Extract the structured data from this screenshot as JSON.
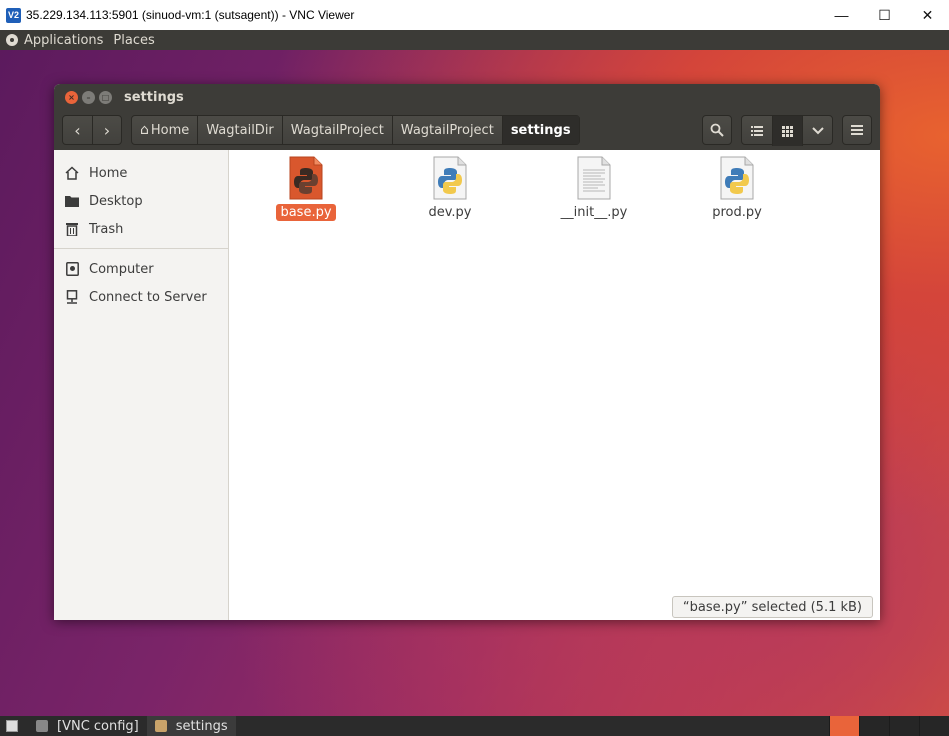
{
  "vnc": {
    "logo": "V2",
    "title": "35.229.134.113:5901 (sinuod-vm:1 (sutsagent)) - VNC Viewer",
    "minimize": "—",
    "maximize": "☐",
    "close": "✕"
  },
  "top_panel": {
    "applications": "Applications",
    "places": "Places"
  },
  "window": {
    "title": "settings",
    "nav": {
      "back": "‹",
      "forward": "›"
    },
    "breadcrumbs": [
      "Home",
      "WagtailDir",
      "WagtailProject",
      "WagtailProject",
      "settings"
    ],
    "tools": {
      "search": "🔍",
      "list_view": "☰",
      "grid_view": "⋮⋮",
      "view_options": "⌄",
      "menu": "≡"
    }
  },
  "sidebar": {
    "items": [
      {
        "label": "Home",
        "icon": "home-icon"
      },
      {
        "label": "Desktop",
        "icon": "folder-icon"
      },
      {
        "label": "Trash",
        "icon": "trash-icon"
      },
      {
        "label": "Computer",
        "icon": "computer-icon"
      },
      {
        "label": "Connect to Server",
        "icon": "server-icon"
      }
    ]
  },
  "files": [
    {
      "name": "base.py",
      "type": "python",
      "selected": true
    },
    {
      "name": "dev.py",
      "type": "python",
      "selected": false
    },
    {
      "name": "__init__.py",
      "type": "text",
      "selected": false
    },
    {
      "name": "prod.py",
      "type": "python",
      "selected": false
    }
  ],
  "status": "“base.py” selected  (5.1 kB)",
  "taskbar": {
    "tasks": [
      {
        "label": "[VNC config]"
      },
      {
        "label": "settings"
      }
    ]
  },
  "colors": {
    "accent": "#e9643a",
    "panel": "#3c3b37",
    "header": "#3d3c38"
  }
}
